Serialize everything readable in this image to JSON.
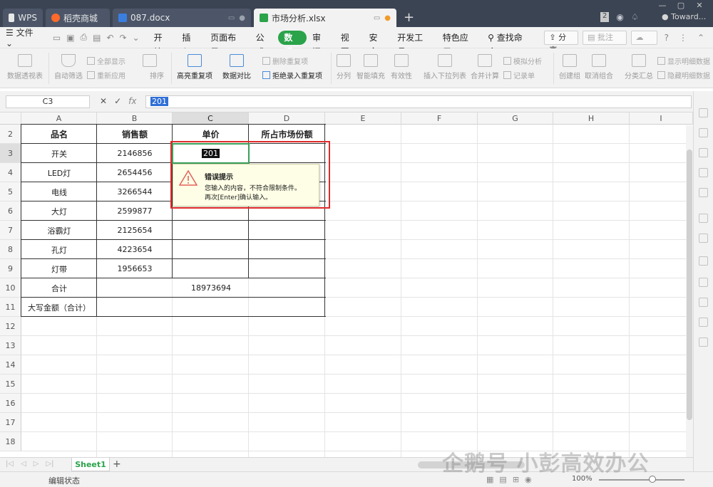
{
  "titlebar": {
    "tabs": [
      {
        "label": "WPS"
      },
      {
        "label": "稻壳商城"
      },
      {
        "label": "087.docx"
      },
      {
        "label": "市场分析.xlsx"
      }
    ],
    "user": "Toward...",
    "badge": "2"
  },
  "menubar": {
    "file": "文件",
    "items": [
      "开始",
      "插入",
      "页面布局",
      "公式",
      "数据",
      "审阅",
      "视图",
      "安全",
      "开发工具",
      "特色应用"
    ],
    "active": "数据",
    "search": "查找命令...",
    "share": "分享",
    "annotate": "批注"
  },
  "ribbon": {
    "buttons": [
      {
        "label": "数据透视表",
        "enabled": false
      },
      {
        "label": "自动筛选",
        "enabled": false
      },
      {
        "label": "排序",
        "enabled": false
      },
      {
        "label": "高亮重复项",
        "enabled": true
      },
      {
        "label": "数据对比",
        "enabled": true
      },
      {
        "label": "分列",
        "enabled": false
      },
      {
        "label": "智能填充",
        "enabled": false
      },
      {
        "label": "有效性",
        "enabled": false
      },
      {
        "label": "插入下拉列表",
        "enabled": false
      },
      {
        "label": "合并计算",
        "enabled": false
      },
      {
        "label": "创建组",
        "enabled": false
      },
      {
        "label": "取消组合",
        "enabled": false
      },
      {
        "label": "分类汇总",
        "enabled": false
      }
    ],
    "small": [
      {
        "label": "全部显示",
        "enabled": false
      },
      {
        "label": "重新应用",
        "enabled": false
      },
      {
        "label": "删除重复项",
        "enabled": false
      },
      {
        "label": "拒绝录入重复项",
        "enabled": true
      },
      {
        "label": "模拟分析",
        "enabled": false
      },
      {
        "label": "记录单",
        "enabled": false
      },
      {
        "label": "显示明细数据",
        "enabled": false
      },
      {
        "label": "隐藏明细数据",
        "enabled": false
      }
    ]
  },
  "formula_bar": {
    "cell_ref": "C3",
    "fx": "fx",
    "value": "201"
  },
  "sheet": {
    "columns": [
      "A",
      "B",
      "C",
      "D",
      "E",
      "F",
      "G",
      "H",
      "I"
    ],
    "selected_column": "C",
    "row_numbers": [
      "2",
      "3",
      "4",
      "5",
      "6",
      "7",
      "8",
      "9",
      "10",
      "11",
      "12",
      "13",
      "14",
      "15",
      "16",
      "17",
      "18"
    ],
    "selected_row": "3",
    "header": [
      "品名",
      "销售额",
      "单价",
      "所占市场份额"
    ],
    "rows": [
      {
        "name": "开关",
        "sales": "2146856"
      },
      {
        "name": "LED灯",
        "sales": "2654456"
      },
      {
        "name": "电线",
        "sales": "3266544"
      },
      {
        "name": "大灯",
        "sales": "2599877"
      },
      {
        "name": "浴霸灯",
        "sales": "2125654"
      },
      {
        "name": "孔灯",
        "sales": "4223654"
      },
      {
        "name": "灯带",
        "sales": "1956653"
      }
    ],
    "total_label": "合计",
    "total_value": "18973694",
    "upper_label": "大写金额（合计）",
    "active_cell_value": "201"
  },
  "error_tip": {
    "title": "错误提示",
    "line1": "您输入的内容，不符合限制条件。",
    "line2": "再次[Enter]确认输入。"
  },
  "sheet_tabs": {
    "active": "Sheet1",
    "add": "+"
  },
  "status": {
    "mode": "编辑状态",
    "zoom": "100%"
  },
  "watermark": "企鹅号 小彭高效办公"
}
